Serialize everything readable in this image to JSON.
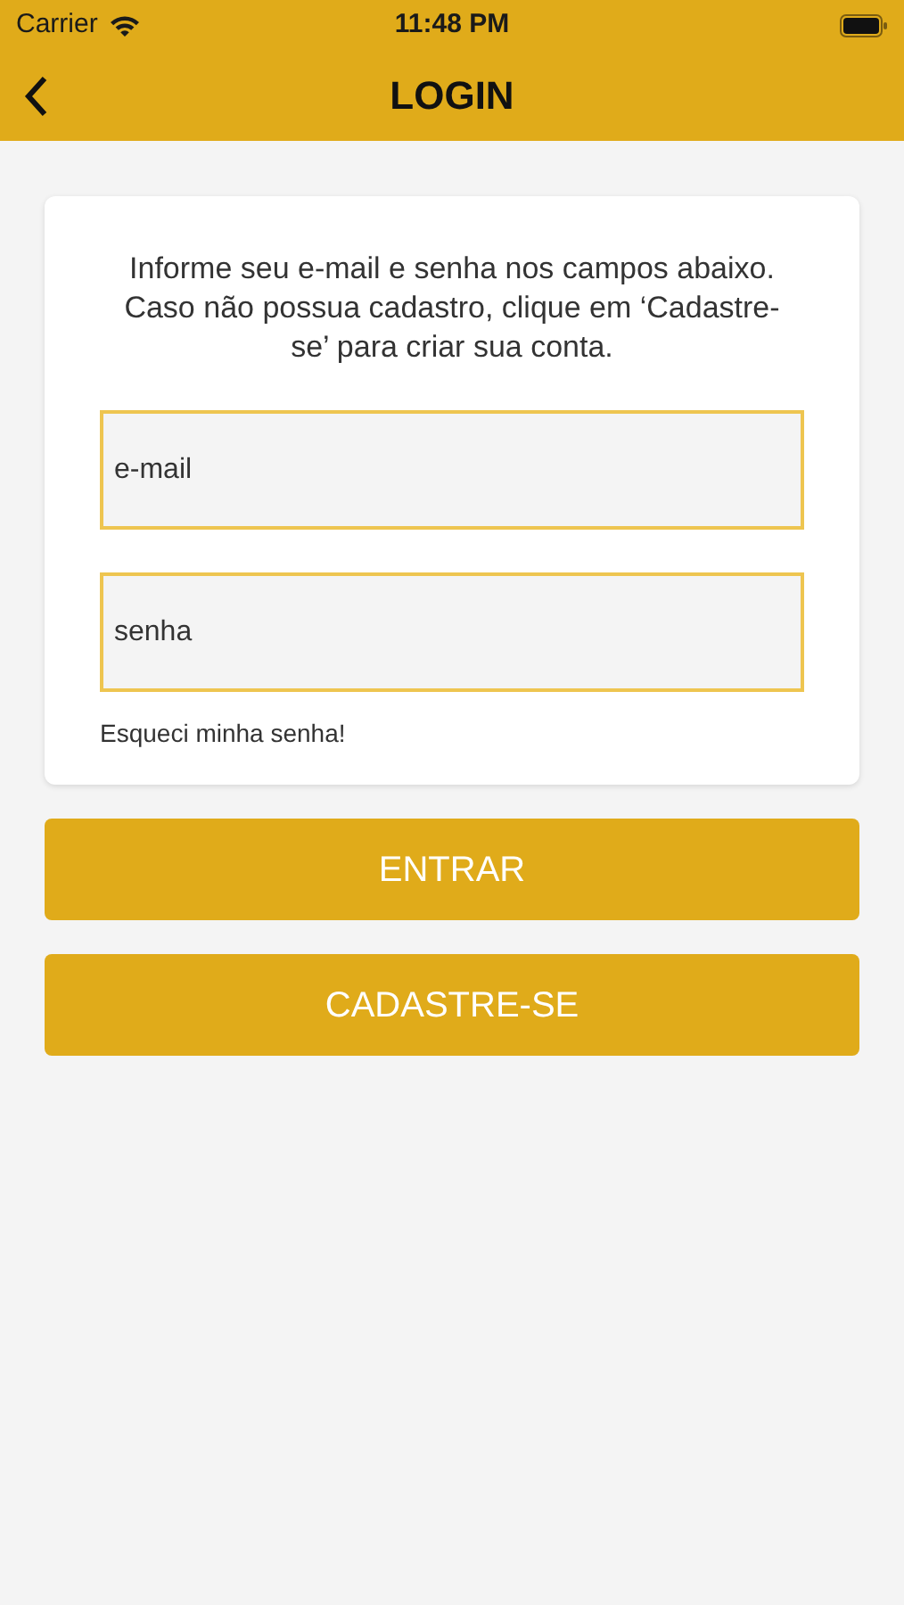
{
  "status_bar": {
    "carrier": "Carrier",
    "time": "11:48 PM"
  },
  "nav": {
    "title": "LOGIN"
  },
  "card": {
    "instructions": "Informe seu e-mail e senha nos campos abaixo. Caso não possua cadastro, clique em ‘Cadastre-se’ para criar sua conta.",
    "fields": [
      {
        "placeholder": "e-mail"
      },
      {
        "placeholder": "senha"
      }
    ],
    "forgot_link": "Esqueci minha senha!"
  },
  "buttons": [
    "ENTRAR",
    "CADASTRE-SE"
  ]
}
